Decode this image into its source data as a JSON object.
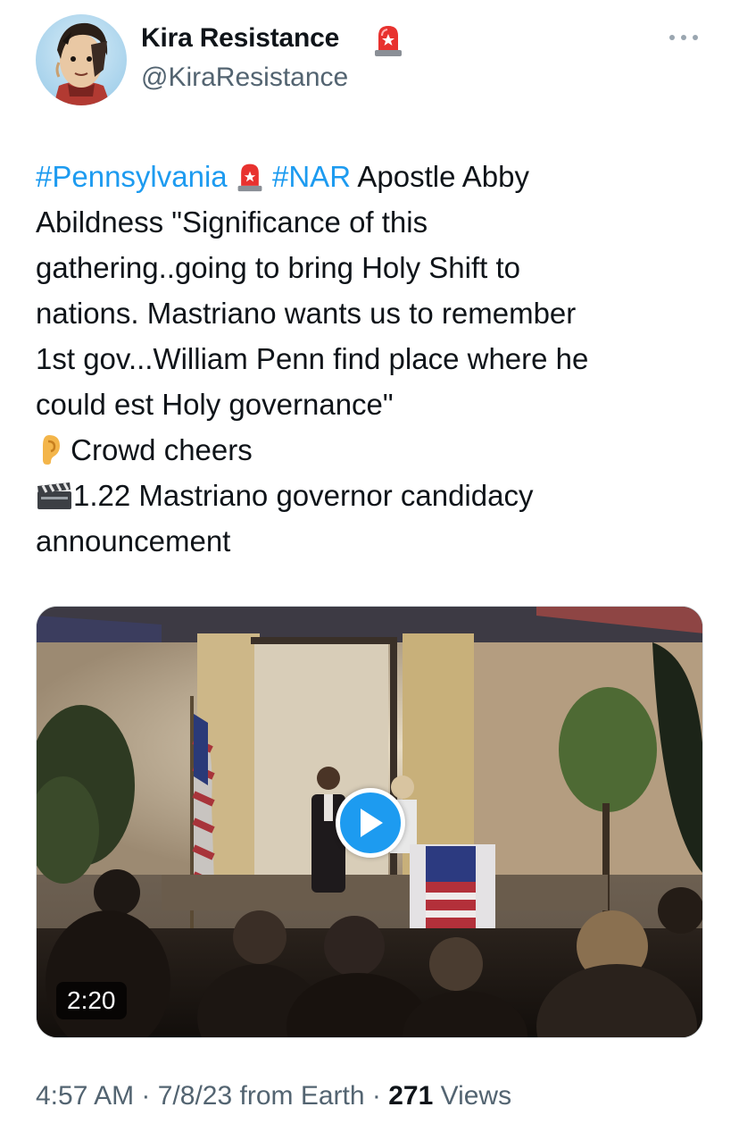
{
  "author": {
    "display_name": "Kira Resistance",
    "handle": "@KiraResistance",
    "badge_icon": "police-siren-icon"
  },
  "tweet": {
    "lines": [
      {
        "hashtag1": "#Pennsylvania",
        "emoji": "police-siren-icon",
        "hashtag2": "#NAR",
        "rest": " Apostle Abby"
      },
      "Abildness \"Significance of this",
      "gathering..going to bring Holy Shift to",
      "nations. Mastriano wants us to remember",
      "1st gov...William Penn find place where he",
      "could est Holy governance\"",
      {
        "emoji": "ear-icon",
        "text": " Crowd cheers"
      },
      {
        "emoji": "clapper-board-icon",
        "text": "1.22 Mastriano governor candidacy"
      },
      "announcement"
    ]
  },
  "media": {
    "duration": "2:20",
    "play_icon": "play-icon"
  },
  "meta": {
    "time": "4:57 AM",
    "sep1": " · ",
    "date": "7/8/23",
    "source": " from Earth",
    "sep2": " · ",
    "views_count": "271",
    "views_label": " Views"
  },
  "colors": {
    "link": "#1d9bf0",
    "text": "#0f1419",
    "secondary": "#536471"
  }
}
